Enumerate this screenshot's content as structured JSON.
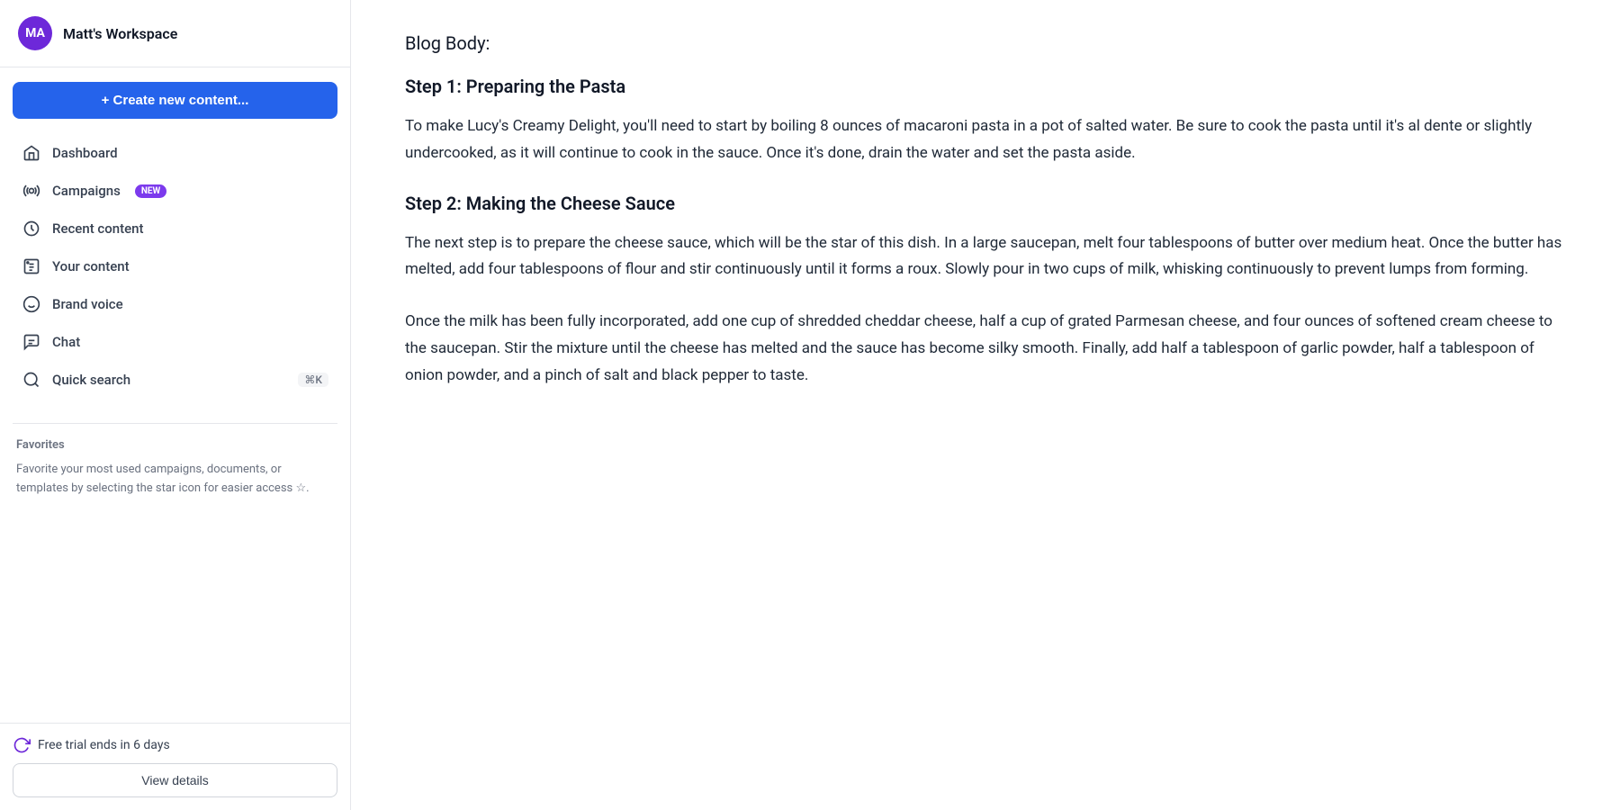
{
  "workspace": {
    "avatar_initials": "MA",
    "name": "Matt's Workspace"
  },
  "sidebar": {
    "create_button_label": "+ Create new content...",
    "nav_items": [
      {
        "id": "dashboard",
        "label": "Dashboard",
        "icon": "home-icon",
        "badge": null
      },
      {
        "id": "campaigns",
        "label": "Campaigns",
        "icon": "campaigns-icon",
        "badge": "NEW"
      },
      {
        "id": "recent-content",
        "label": "Recent content",
        "icon": "recent-icon",
        "badge": null
      },
      {
        "id": "your-content",
        "label": "Your content",
        "icon": "content-icon",
        "badge": null
      },
      {
        "id": "brand-voice",
        "label": "Brand voice",
        "icon": "brand-voice-icon",
        "badge": null
      },
      {
        "id": "chat",
        "label": "Chat",
        "icon": "chat-icon",
        "badge": null
      },
      {
        "id": "quick-search",
        "label": "Quick search",
        "icon": "search-icon",
        "badge": null,
        "shortcut": "⌘K"
      }
    ],
    "favorites_title": "Favorites",
    "favorites_description": "Favorite your most used campaigns, documents, or templates by selecting the star icon for easier access ☆.",
    "trial_text": "Free trial ends in 6 days",
    "view_details_label": "View details"
  },
  "main": {
    "blog_label": "Blog Body:",
    "sections": [
      {
        "heading": "Step 1: Preparing the Pasta",
        "paragraphs": [
          "To make Lucy's Creamy Delight, you'll need to start by boiling 8 ounces of macaroni pasta in a pot of salted water. Be sure to cook the pasta until it's al dente or slightly undercooked, as it will continue to cook in the sauce. Once it's done, drain the water and set the pasta aside."
        ]
      },
      {
        "heading": "Step 2: Making the Cheese Sauce",
        "paragraphs": [
          "The next step is to prepare the cheese sauce, which will be the star of this dish. In a large saucepan, melt four tablespoons of butter over medium heat. Once the butter has melted, add four tablespoons of flour and stir continuously until it forms a roux. Slowly pour in two cups of milk, whisking continuously to prevent lumps from forming.",
          "Once the milk has been fully incorporated, add one cup of shredded cheddar cheese, half a cup of grated Parmesan cheese, and four ounces of softened cream cheese to the saucepan. Stir the mixture until the cheese has melted and the sauce has become silky smooth. Finally, add half a tablespoon of garlic powder, half a tablespoon of onion powder, and a pinch of salt and black pepper to taste."
        ]
      }
    ]
  }
}
